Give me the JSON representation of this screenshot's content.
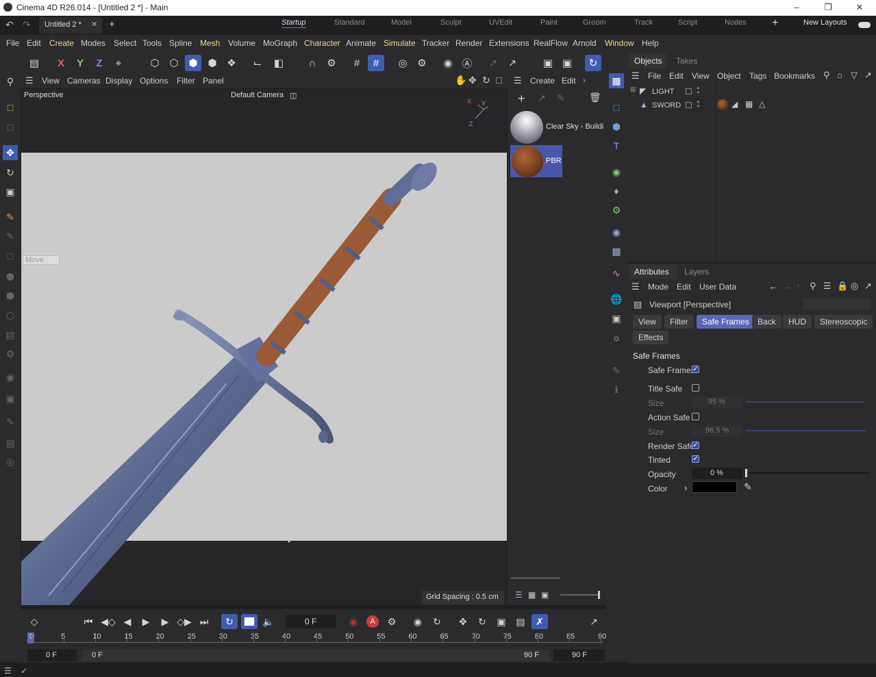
{
  "window": {
    "title": "Cinema 4D R26.014 - [Untitled 2 *] - Main"
  },
  "doc_tab": {
    "label": "Untitled 2 *"
  },
  "layouts": [
    "Startup",
    "Standard",
    "Model",
    "Sculpt",
    "UVEdit",
    "Paint",
    "Groom",
    "Track",
    "Script",
    "Nodes"
  ],
  "new_layouts": "New Layouts",
  "menu": [
    "File",
    "Edit",
    "Create",
    "Modes",
    "Select",
    "Tools",
    "Spline",
    "Mesh",
    "Volume",
    "MoGraph",
    "Character",
    "Animate",
    "Simulate",
    "Tracker",
    "Render",
    "Extensions",
    "RealFlow",
    "Arnold",
    "Window",
    "Help"
  ],
  "viewport": {
    "menu": [
      "View",
      "Cameras",
      "Display",
      "Options",
      "Filter",
      "Panel"
    ],
    "name": "Perspective",
    "camera": "Default Camera",
    "move_hint": "Move",
    "grid": "Grid Spacing : 0.5 cm",
    "axis_x": "X",
    "axis_y": "Y",
    "axis_z": "Z"
  },
  "materials": {
    "menu": [
      "Create",
      "Edit"
    ],
    "items": [
      {
        "name": "Clear Sky - Buildi"
      },
      {
        "name": "PBR"
      }
    ]
  },
  "objects": {
    "tabs": [
      "Objects",
      "Takes"
    ],
    "menu": [
      "File",
      "Edit",
      "View",
      "Object",
      "Tags",
      "Bookmarks"
    ],
    "items": [
      "LIGHT",
      "SWORD"
    ]
  },
  "attributes": {
    "tabs": [
      "Attributes",
      "Layers"
    ],
    "menu": [
      "Mode",
      "Edit",
      "User Data"
    ],
    "title": "Viewport [Perspective]",
    "buttons": [
      "View",
      "Filter",
      "Safe Frames",
      "Back",
      "HUD",
      "Stereoscopic",
      "Effects"
    ],
    "section": "Safe Frames",
    "fields": {
      "safe_frames": "Safe Frames",
      "title_safe": "Title Safe",
      "size1": "Size",
      "size1_val": "95 %",
      "action_safe": "Action Safe",
      "size2": "Size",
      "size2_val": "96.5 %",
      "render_safe": "Render Safe",
      "tinted": "Tinted",
      "opacity": "Opacity",
      "opacity_val": "0 %",
      "color": "Color"
    }
  },
  "timeline": {
    "frame": "0 F",
    "ticks": [
      "0",
      "5",
      "10",
      "15",
      "20",
      "25",
      "30",
      "35",
      "40",
      "45",
      "50",
      "55",
      "60",
      "65",
      "70",
      "75",
      "80",
      "85",
      "90"
    ],
    "start": "0 F",
    "range_start": "0 F",
    "range_end": "90 F",
    "end": "90 F"
  }
}
